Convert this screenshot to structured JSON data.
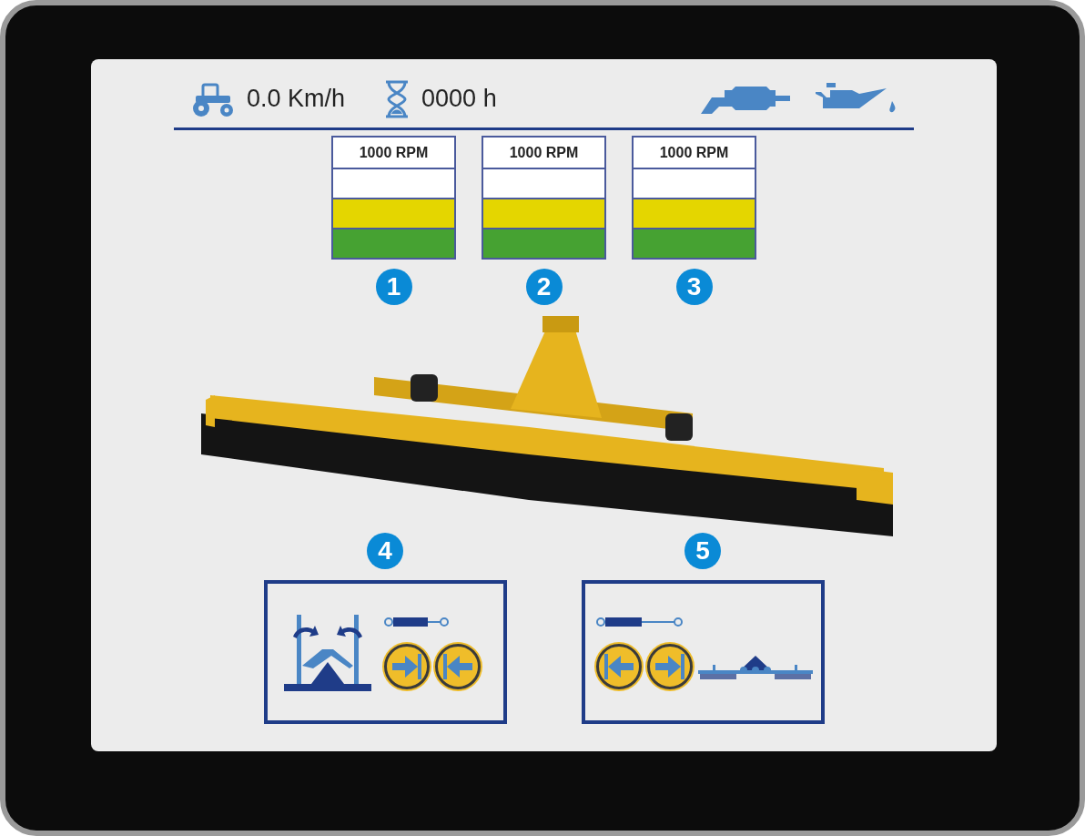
{
  "status_bar": {
    "speed": "0.0 Km/h",
    "hours": "0000 h"
  },
  "gauges": [
    {
      "label": "1000 RPM",
      "number": "1"
    },
    {
      "label": "1000 RPM",
      "number": "2"
    },
    {
      "label": "1000 RPM",
      "number": "3"
    }
  ],
  "panels": [
    {
      "number": "4",
      "kind": "fold",
      "buttons": [
        {
          "kind": "forward"
        },
        {
          "kind": "back"
        }
      ]
    },
    {
      "number": "5",
      "kind": "roller",
      "buttons": [
        {
          "kind": "back"
        },
        {
          "kind": "forward"
        }
      ]
    }
  ]
}
